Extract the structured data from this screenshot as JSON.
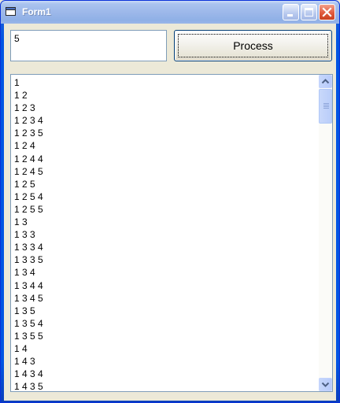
{
  "window": {
    "title": "Form1"
  },
  "input": {
    "value": "5"
  },
  "button": {
    "label": "Process"
  },
  "list": {
    "items": [
      "1",
      "1 2",
      "1 2 3",
      "1 2 3 4",
      "1 2 3 5",
      "1 2 4",
      "1 2 4 4",
      "1 2 4 5",
      "1 2 5",
      "1 2 5 4",
      "1 2 5 5",
      "1 3",
      "1 3 3",
      "1 3 3 4",
      "1 3 3 5",
      "1 3 4",
      "1 3 4 4",
      "1 3 4 5",
      "1 3 5",
      "1 3 5 4",
      "1 3 5 5",
      "1 4",
      "1 4 3",
      "1 4 3 4",
      "1 4 3 5"
    ]
  },
  "icons": {
    "title": "form-icon",
    "minimize": "minimize-icon",
    "maximize": "maximize-icon",
    "close": "close-icon"
  },
  "colors": {
    "titlebar": "#9db8ea",
    "close_button": "#e05a3d",
    "face": "#ece9d8"
  }
}
